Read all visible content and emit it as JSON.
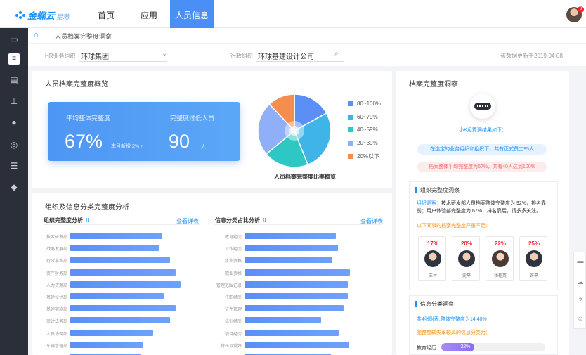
{
  "topbar": {
    "logo_text": "金蝶云",
    "logo_sub": "星瀚",
    "tabs": [
      {
        "label": "首页"
      },
      {
        "label": "应用"
      },
      {
        "label": "人员信息",
        "active": true
      }
    ],
    "notification_count": "8"
  },
  "sidebar": {
    "icons": [
      "monitor-icon",
      "document-icon",
      "clipboard-icon",
      "org-chart-icon",
      "user-settings-icon",
      "compass-icon",
      "list-icon",
      "layers-icon"
    ],
    "active_index": 1
  },
  "breadcrumb": {
    "text": "人员档案完整度洞察"
  },
  "filters": {
    "hr_org_label": "HR业务组织",
    "hr_org_value": "环球集团",
    "admin_org_label": "行政组织",
    "admin_org_value": "环球基建设计公司",
    "update_time": "该数据更新于2019-04-08"
  },
  "overview": {
    "title": "人员档案完整度概览",
    "avg_label": "平均整体完整度",
    "avg_value": "67%",
    "month_delta": "本月新增 2% ↑",
    "over_label": "完整度过低人员",
    "over_value": "90",
    "over_unit": "人",
    "pie_caption": "人员档案完整度比率概览"
  },
  "chart_data": [
    {
      "type": "pie",
      "title": "人员档案完整度比率概览",
      "categories": [
        "80~100%",
        "60~79%",
        "40~59%",
        "20~39%",
        "20%以下"
      ],
      "values": [
        17,
        27,
        20,
        24,
        12
      ],
      "colors": [
        "#5b8ff5",
        "#3fb4e8",
        "#2ec8c4",
        "#8fb0f9",
        "#f58d4f"
      ],
      "legend": "right"
    },
    {
      "type": "bar",
      "title": "组织完整度分析",
      "orientation": "horizontal",
      "categories": [
        "技术研发部",
        "战略发展部",
        "行政事业部",
        "资产财务部",
        "人力资源部",
        "基建设计部",
        "基建实施部",
        "审计法务部",
        "人员协调部",
        "车辆管理部",
        "市场服务部"
      ],
      "values": [
        82,
        79,
        89,
        94,
        98,
        83,
        94,
        89,
        74,
        65,
        63
      ]
    },
    {
      "type": "bar",
      "title": "信息分类占比分析",
      "orientation": "horizontal",
      "categories": [
        "教育经历",
        "工作经历",
        "执业资格",
        "职业资格",
        "管理范围记录",
        "任职经历",
        "证件管理",
        "培训经历",
        "项目经历",
        "特长及爱好",
        "职称信息"
      ],
      "values": [
        81,
        83,
        78,
        94,
        92,
        92,
        88,
        68,
        84,
        93,
        77
      ]
    }
  ],
  "analysis": {
    "title": "组织及信息分类完整度分析",
    "org_subtitle": "组织完整度分析",
    "info_subtitle": "信息分类占比分析",
    "filter_marker": "⇅",
    "detail_link": "查看详表"
  },
  "insight": {
    "title": "档案完整度洞察",
    "bot_caption": "小K运算洞结果如下：",
    "pill_info": "在选定的业务组织和组织下，共有正式员工95人",
    "pill_warn": "档案整体平均完整度为67%，共有40人达到100%",
    "org_panel": {
      "title": "组织完整度洞察",
      "text_prefix": "组织洞察：",
      "text_body": "技术研发部人员档案整体完整度为 92%，排名靠前；用户体验部完整度为 67%，排名靠后，请多多关注。",
      "warn_line": "以下同事的档案完整度严重不足：",
      "employees": [
        {
          "pct": "17%",
          "name": "王林"
        },
        {
          "pct": "20%",
          "name": "史平"
        },
        {
          "pct": "22%",
          "name": "杨桂英"
        },
        {
          "pct": "25%",
          "name": "许平"
        }
      ]
    },
    "info_panel": {
      "title": "信息分类洞察",
      "line1": "共4张附表,整体完整度为14.40%",
      "line2": "完整度缺失率较高的信息分类为：",
      "progress_label": "教育经历",
      "progress_value": "32%",
      "progress_fraction": 0.32
    }
  },
  "float_tools": [
    "minus-icon",
    "cloud-icon",
    "help-icon",
    "feedback-icon"
  ]
}
